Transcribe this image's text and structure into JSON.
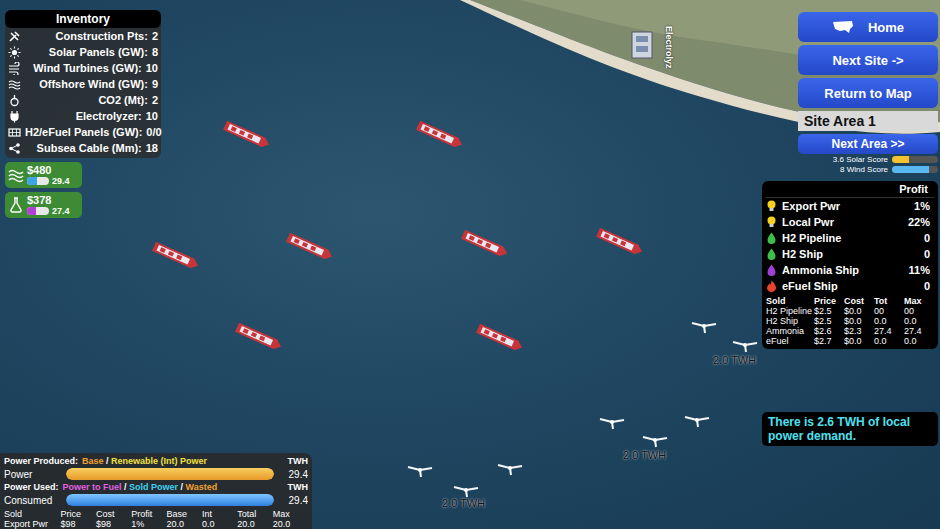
{
  "inventory": {
    "title": "Inventory",
    "items": [
      {
        "kind": "tools",
        "label": "Construction Pts:",
        "value": "2"
      },
      {
        "kind": "sun",
        "label": "Solar Panels (GW):",
        "value": "8"
      },
      {
        "kind": "wind",
        "label": "Wind Turbines (GW):",
        "value": "10"
      },
      {
        "kind": "wave",
        "label": "Offshore Wind (GW):",
        "value": "9"
      },
      {
        "kind": "co2",
        "label": "CO2 (Mt):",
        "value": "2"
      },
      {
        "kind": "plug",
        "label": "Electrolyzer:",
        "value": "10"
      },
      {
        "kind": "panel",
        "label": "H2/eFuel Panels (GW):",
        "value": "0/0"
      },
      {
        "kind": "cable",
        "label": "Subsea Cable (Mm):",
        "value": "18"
      }
    ]
  },
  "funds": [
    {
      "kind": "wave",
      "amount": "$480",
      "level": 0.45,
      "reading": "29.4",
      "color": "#3aa6e8"
    },
    {
      "kind": "flask",
      "amount": "$378",
      "level": 0.4,
      "reading": "27.4",
      "color": "#b23fd6"
    }
  ],
  "nav": {
    "buttons": [
      "Home",
      "Next Site ->",
      "Return to Map"
    ],
    "site": "Site Area 1",
    "next_area": "Next Area >>"
  },
  "scores": [
    {
      "label": "3.6 Solar Score",
      "level": 0.36,
      "color": "#f2c230"
    },
    {
      "label": "8 Wind Score",
      "level": 0.8,
      "color": "#5ab8f0"
    }
  ],
  "profit": {
    "title": "Profit",
    "rows": [
      {
        "kind": "bulb",
        "color": "#f5d020",
        "label": "Export Pwr",
        "value": "1%"
      },
      {
        "kind": "bulb",
        "color": "#f5d020",
        "label": "Local Pwr",
        "value": "22%"
      },
      {
        "kind": "drop",
        "color": "#3fbf4a",
        "label": "H2 Pipeline",
        "value": "0"
      },
      {
        "kind": "drop",
        "color": "#3fbf4a",
        "label": "H2 Ship",
        "value": "0"
      },
      {
        "kind": "drop",
        "color": "#a040d0",
        "label": "Ammonia Ship",
        "value": "11%"
      },
      {
        "kind": "flame",
        "color": "#e8452a",
        "label": "eFuel Ship",
        "value": "0"
      }
    ],
    "table": {
      "columns": [
        "Sold",
        "Price",
        "Cost",
        "Tot",
        "Max"
      ],
      "rows": [
        [
          "H2 Pipeline",
          "$2.5",
          "$0.0",
          "00",
          "00"
        ],
        [
          "H2 Ship",
          "$2.5",
          "$0.0",
          "0.0",
          "0.0"
        ],
        [
          "Ammonia",
          "$2.6",
          "$2.3",
          "27.4",
          "27.4"
        ],
        [
          "eFuel",
          "$2.7",
          "$0.0",
          "0.0",
          "0.0"
        ]
      ]
    }
  },
  "message": "There is 2.6 TWH of local power demand.",
  "power": {
    "produced": {
      "label": "Power Produced:",
      "segments": [
        {
          "text": "Base",
          "color": "#f0a030"
        },
        {
          "text": " / ",
          "color": "#ffffff"
        },
        {
          "text": "Renewable (Int) Power",
          "color": "#f0e040"
        }
      ],
      "unit": "TWH",
      "bar_label": "Power",
      "level": 1,
      "reading": "29.4"
    },
    "used": {
      "label": "Power Used:",
      "segments": [
        {
          "text": "Power to Fuel",
          "color": "#e060e0"
        },
        {
          "text": " / ",
          "color": "#ffffff"
        },
        {
          "text": "Sold Power",
          "color": "#40d0f0"
        },
        {
          "text": " / ",
          "color": "#ffffff"
        },
        {
          "text": "Wasted",
          "color": "#f0a030"
        }
      ],
      "unit": "TWH",
      "bar_label": "Consumed",
      "level": 1,
      "reading": "29.4"
    },
    "table": {
      "columns": [
        "Sold",
        "Price",
        "Cost",
        "Profit",
        "Base",
        "Int",
        "Total",
        "Max"
      ],
      "rows": [
        [
          "Export Pwr",
          "$98",
          "$98",
          "1%",
          "20.0",
          "0.0",
          "20.0",
          "20.0"
        ]
      ]
    }
  },
  "map": {
    "building_label": "Electrolyz",
    "farm_labels": [
      "2.0 TWH",
      "2.0 TWH",
      "2.0 TWH"
    ]
  }
}
